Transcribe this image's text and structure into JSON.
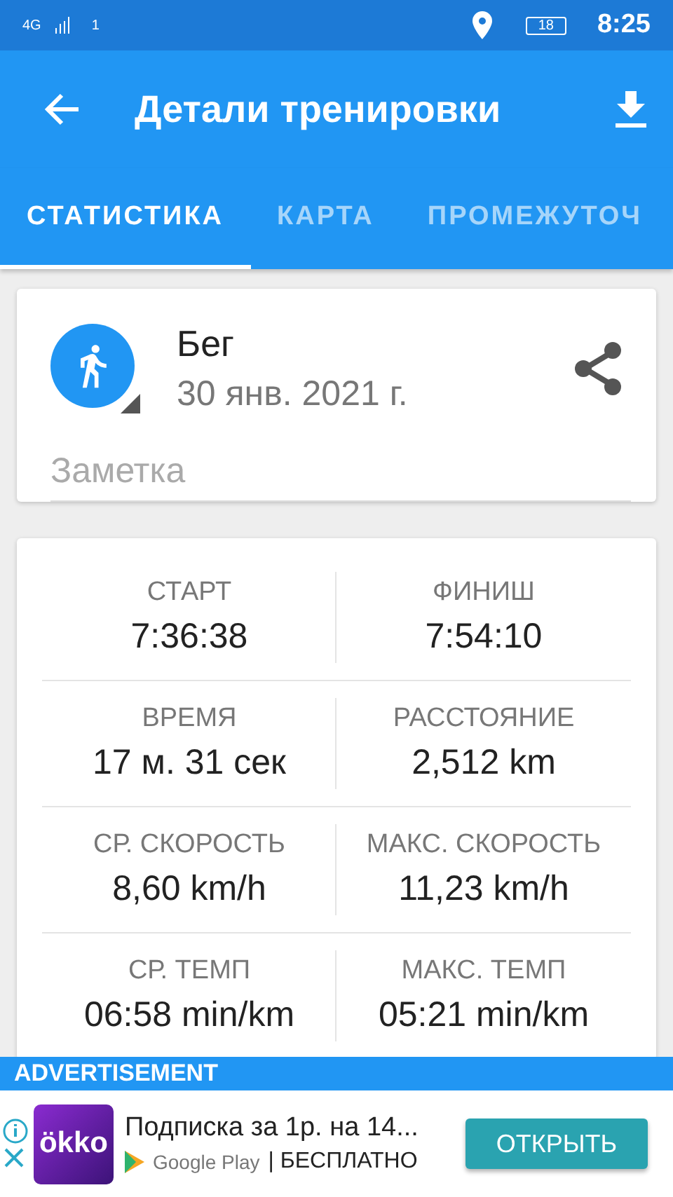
{
  "status_bar": {
    "network": "4G",
    "sim": "1",
    "battery": "18",
    "time": "8:25"
  },
  "app_bar": {
    "title": "Детали тренировки"
  },
  "tabs": [
    {
      "label": "СТАТИСТИКА",
      "selected": true
    },
    {
      "label": "КАРТА",
      "selected": false
    },
    {
      "label": "ПРОМЕЖУТОЧ",
      "selected": false
    }
  ],
  "workout": {
    "activity": "Бег",
    "date": "30 янв. 2021 г.",
    "note": {
      "placeholder": "Заметка"
    }
  },
  "stats": [
    {
      "label": "СТАРТ",
      "value": "7:36:38"
    },
    {
      "label": "ФИНИШ",
      "value": "7:54:10"
    },
    {
      "label": "ВРЕМЯ",
      "value": "17 м. 31 сек"
    },
    {
      "label": "РАССТОЯНИЕ",
      "value": "2,512 km"
    },
    {
      "label": "СР. СКОРОСТЬ",
      "value": "8,60 km/h"
    },
    {
      "label": "МАКС. СКОРОСТЬ",
      "value": "11,23 km/h"
    },
    {
      "label": "СР. ТЕМП",
      "value": "06:58 min/km"
    },
    {
      "label": "МАКС. ТЕМП",
      "value": "05:21 min/km"
    }
  ],
  "ad": {
    "header": "ADVERTISEMENT",
    "brand": "ökko",
    "title": "Подписка за 1р. на 14...",
    "store": "Google Play",
    "price": "| БЕСПЛАТНО",
    "button": "ОТКРЫТЬ"
  }
}
